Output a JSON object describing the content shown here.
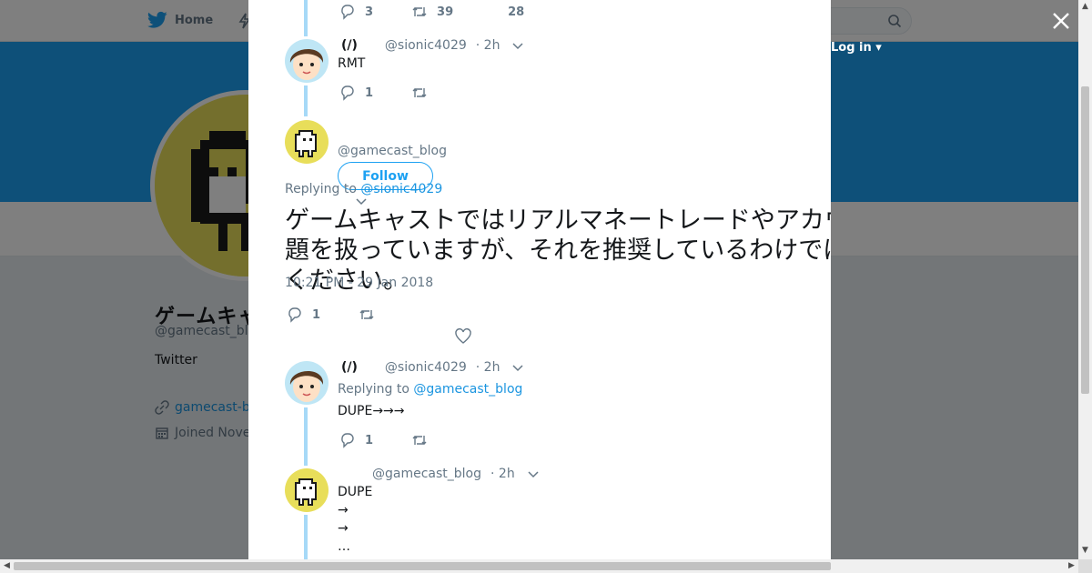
{
  "nav": {
    "home_label": "Home",
    "login_label": "Log in ▾"
  },
  "profile": {
    "name": "ゲームキャスト",
    "handle": "@gamecast_blog",
    "bio": "Twitter",
    "link": "gamecast-b",
    "joined": "Joined Nove"
  },
  "modal": {
    "top_actions": {
      "reply_count": "3",
      "retweet_count": "39",
      "like_count": "28"
    },
    "tweet1": {
      "display_name": "(/)",
      "handle": "@sionic4029",
      "time": "· 2h",
      "text": "RMT",
      "reply_count": "1"
    },
    "main_tweet": {
      "handle": "@gamecast_blog",
      "follow_label": "Follow",
      "replying_prefix": "Replying to",
      "replying_handle": "@sionic4029",
      "text": "ゲームキャストではリアルマネートレードやアカウント販売についての話題を扱っていますが、それを推奨しているわけではありませんのでご注意ください。",
      "timestamp": "10:21 PM - 29 Jan 2018",
      "reply_count": "1"
    },
    "tweet2": {
      "display_name": "(/)",
      "handle": "@sionic4029",
      "time": "· 2h",
      "replying_prefix": "Replying to",
      "replying_handle": "@gamecast_blog",
      "text": "DUPE→→→",
      "reply_count": "1"
    },
    "tweet3": {
      "handle": "@gamecast_blog",
      "time": "· 2h",
      "lines": [
        "DUPE",
        "→",
        "→",
        "…"
      ]
    }
  },
  "colors": {
    "brand": "#1da1f2",
    "thread": "#a6d9f7",
    "text": "#14171a",
    "muted": "#657786"
  }
}
